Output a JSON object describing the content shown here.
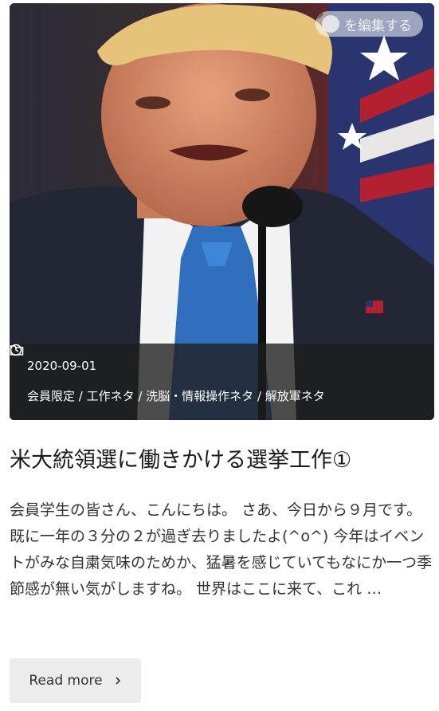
{
  "post": {
    "edit_label": "を編集する",
    "date": "2020-09-01",
    "categories": "会員限定 / 工作ネタ / 洗脳・情報操作ネタ / 解放軍ネタ",
    "title": "米大統領選に働きかける選挙工作①",
    "excerpt": "会員学生の皆さん、こんにちは。 さあ、今日から９月です。既に一年の３分の２が過ぎ去りましたよ(^o^) 今年はイベントがみな自粛気味のためか、猛暑を感じていてもなにか一つ季節感が無い気がしますね。 世界はここに来て、これ …",
    "read_more": "Read more"
  },
  "icons": {
    "edit": "pencil-icon",
    "date": "clock-icon",
    "category": "folder-icon",
    "read_more": "chevron-right-icon"
  }
}
